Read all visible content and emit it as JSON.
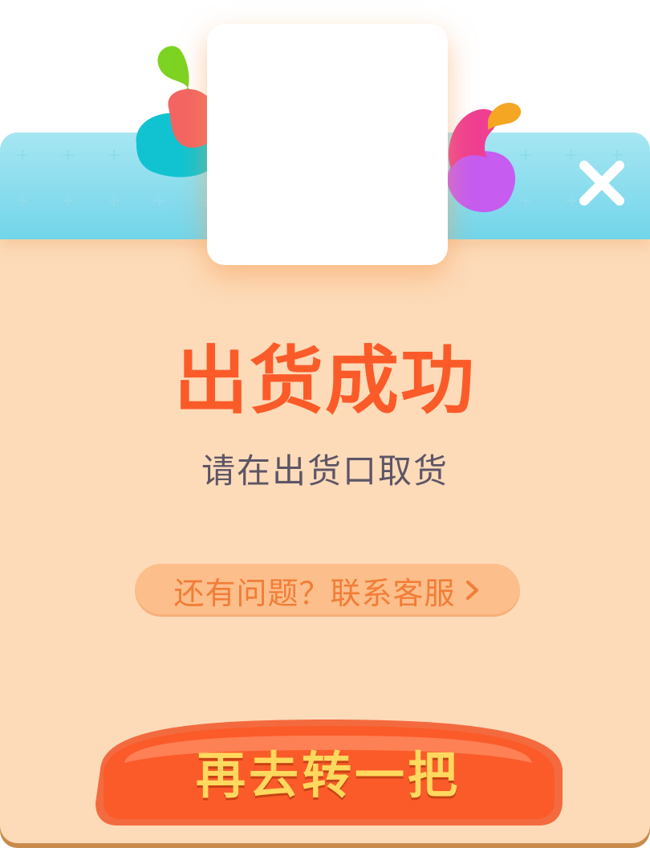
{
  "dialog": {
    "title": "出货成功",
    "subtitle": "请在出货口取货",
    "support_link": "还有问题？联系客服",
    "cta_label": "再去转一把"
  },
  "icons": {
    "close": "close-icon",
    "chevron": "chevron-right-icon"
  },
  "colors": {
    "header_top": "#a6e6f2",
    "header_bottom": "#72d5ea",
    "panel": "#fddbb9",
    "title": "#fb5b29",
    "subtitle": "#5d5566",
    "link_pill": "#fcbe8a",
    "link_text": "#f27d37",
    "cta_button": "#fb5b29",
    "cta_text": "#ffd95e"
  }
}
